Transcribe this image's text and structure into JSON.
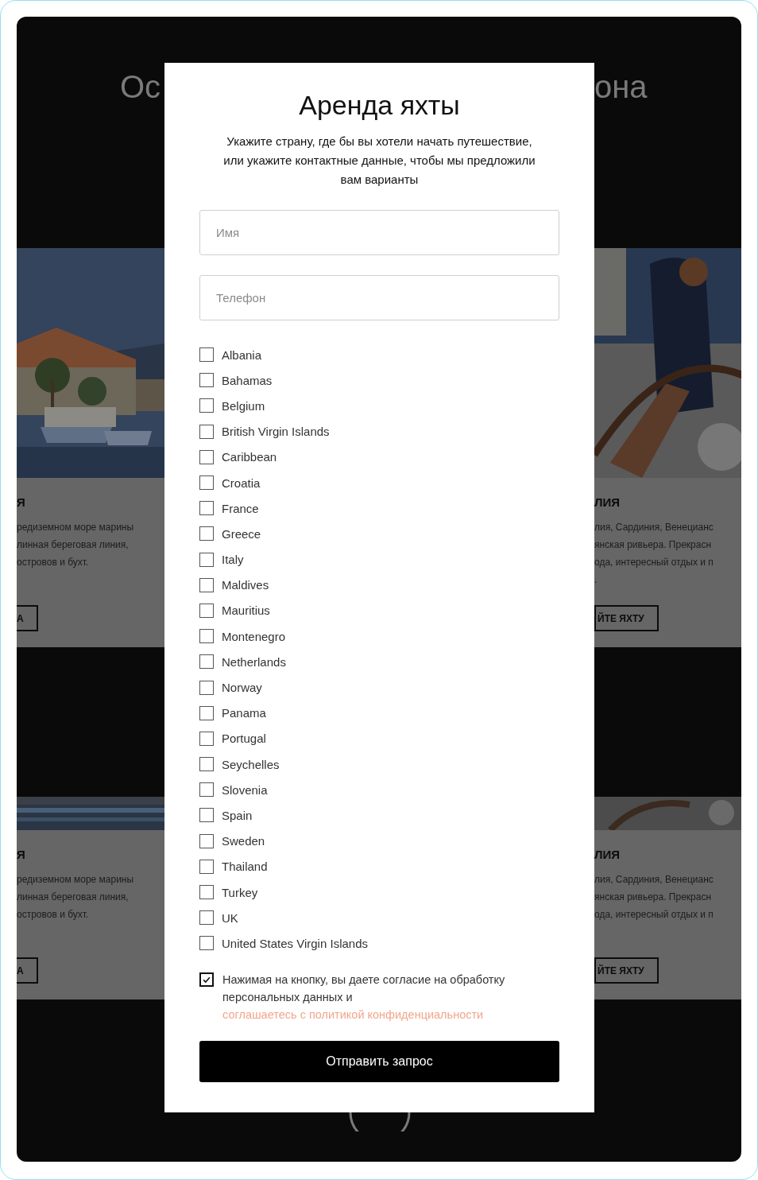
{
  "left_column": {
    "heading": "Ос",
    "cards": [
      {
        "title": "Я",
        "lines": [
          "редиземном море марины",
          "линная береговая линия,",
          "островов и бухт."
        ],
        "button": "А"
      },
      {
        "title": "Я",
        "lines": [
          "редиземном море марины",
          "линная береговая линия,",
          "островов и бухт."
        ],
        "button": "А"
      }
    ]
  },
  "right_column": {
    "heading": "она",
    "cards": [
      {
        "title": "ЛИЯ",
        "lines": [
          "лия, Сардиния, Венецианс",
          "янская ривьера. Прекрасн",
          "ода, интересный отдых и п",
          "."
        ],
        "button": "ЙТЕ ЯХТУ"
      },
      {
        "title": "ЛИЯ",
        "lines": [
          "лия, Сардиния, Венецианс",
          "янская ривьера. Прекрасн",
          "ода, интересный отдых и п"
        ],
        "button": "ЙТЕ ЯХТУ"
      }
    ]
  },
  "modal": {
    "title": "Аренда яхты",
    "subtitle": "Укажите страну, где бы вы хотели начать путешествие, или укажите контактные данные, чтобы мы предложили вам варианты",
    "fields": [
      {
        "placeholder": "Имя"
      },
      {
        "placeholder": "Телефон"
      }
    ],
    "countries": [
      {
        "label": "Albania",
        "checked": false
      },
      {
        "label": "Bahamas",
        "checked": false
      },
      {
        "label": "Belgium",
        "checked": false
      },
      {
        "label": "British Virgin Islands",
        "checked": false
      },
      {
        "label": "Caribbean",
        "checked": false
      },
      {
        "label": "Croatia",
        "checked": false
      },
      {
        "label": "France",
        "checked": false
      },
      {
        "label": "Greece",
        "checked": false
      },
      {
        "label": "Italy",
        "checked": false
      },
      {
        "label": "Maldives",
        "checked": false
      },
      {
        "label": "Mauritius",
        "checked": false
      },
      {
        "label": "Montenegro",
        "checked": false
      },
      {
        "label": "Netherlands",
        "checked": false
      },
      {
        "label": "Norway",
        "checked": false
      },
      {
        "label": "Panama",
        "checked": false
      },
      {
        "label": "Portugal",
        "checked": false
      },
      {
        "label": "Seychelles",
        "checked": false
      },
      {
        "label": "Slovenia",
        "checked": false
      },
      {
        "label": "Spain",
        "checked": false
      },
      {
        "label": "Sweden",
        "checked": false
      },
      {
        "label": "Thailand",
        "checked": false
      },
      {
        "label": "Turkey",
        "checked": false
      },
      {
        "label": "UK",
        "checked": false
      },
      {
        "label": "United States Virgin Islands",
        "checked": false
      }
    ],
    "consent": {
      "checked": true,
      "text": "Нажимая на кнопку, вы даете согласие на обработку персональных данных и ",
      "link": "соглашаетесь с политикой конфиденциальности"
    },
    "submit": "Отправить запрос"
  }
}
